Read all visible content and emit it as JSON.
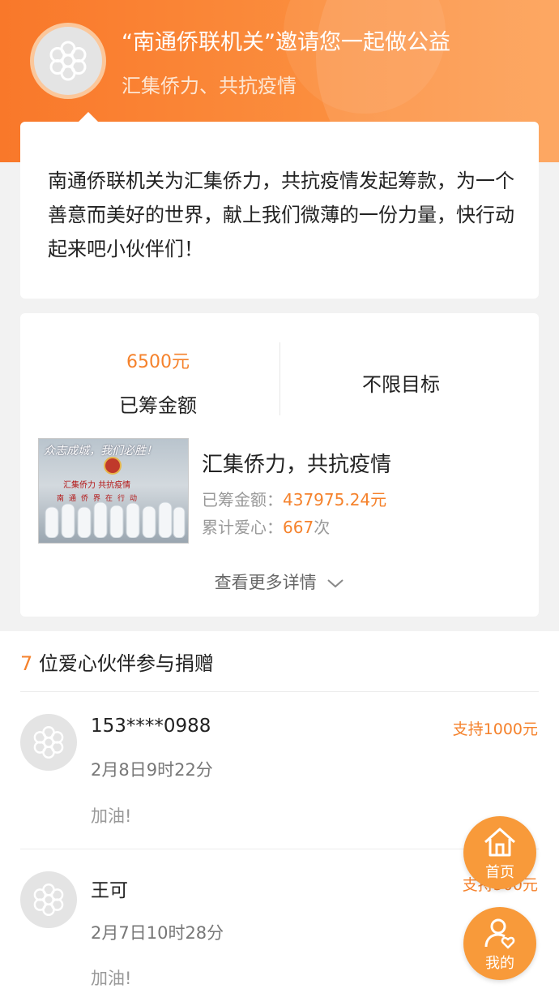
{
  "header": {
    "title": "“南通侨联机关”邀请您一起做公益",
    "subtitle": "汇集侨力、共抗疫情"
  },
  "intro": {
    "text": "南通侨联机关为汇集侨力，共抗疫情发起筹款，为一个善意而美好的世界，献上我们微薄的一份力量，快行动起来吧小伙伴们！"
  },
  "stats": {
    "raised_amount": "6500元",
    "raised_label": "已筹金额",
    "goal_label": "不限目标"
  },
  "project": {
    "image_caption": "众志成城，我们必胜！",
    "image_banner_1": "汇集侨力 共抗疫情",
    "image_banner_2": "南通侨界在行动",
    "title": "汇集侨力，共抗疫情",
    "raised_label": "已筹金额：",
    "raised_value": "437975.24",
    "raised_unit": "元",
    "love_label": "累计爱心：",
    "love_value": "667",
    "love_unit": "次",
    "more_link": "查看更多详情"
  },
  "donors": {
    "count": "7",
    "title_suffix": " 位爱心伙伴参与捐赠",
    "items": [
      {
        "name": "153****0988",
        "time": "2月8日9时22分",
        "message": "加油!",
        "amount": "支持1000元"
      },
      {
        "name": "王可",
        "time": "2月7日10时28分",
        "message": "加油!",
        "amount": "支持500元"
      }
    ]
  },
  "fabs": {
    "home_label": "首页",
    "mine_label": "我的"
  },
  "colors": {
    "accent": "#f5822c",
    "header_start": "#f9782a",
    "header_end": "#fd9e52",
    "fab": "#f89a3a"
  },
  "icons": [
    "flower-logo-icon",
    "chevron-down-icon",
    "home-icon",
    "user-heart-icon"
  ]
}
